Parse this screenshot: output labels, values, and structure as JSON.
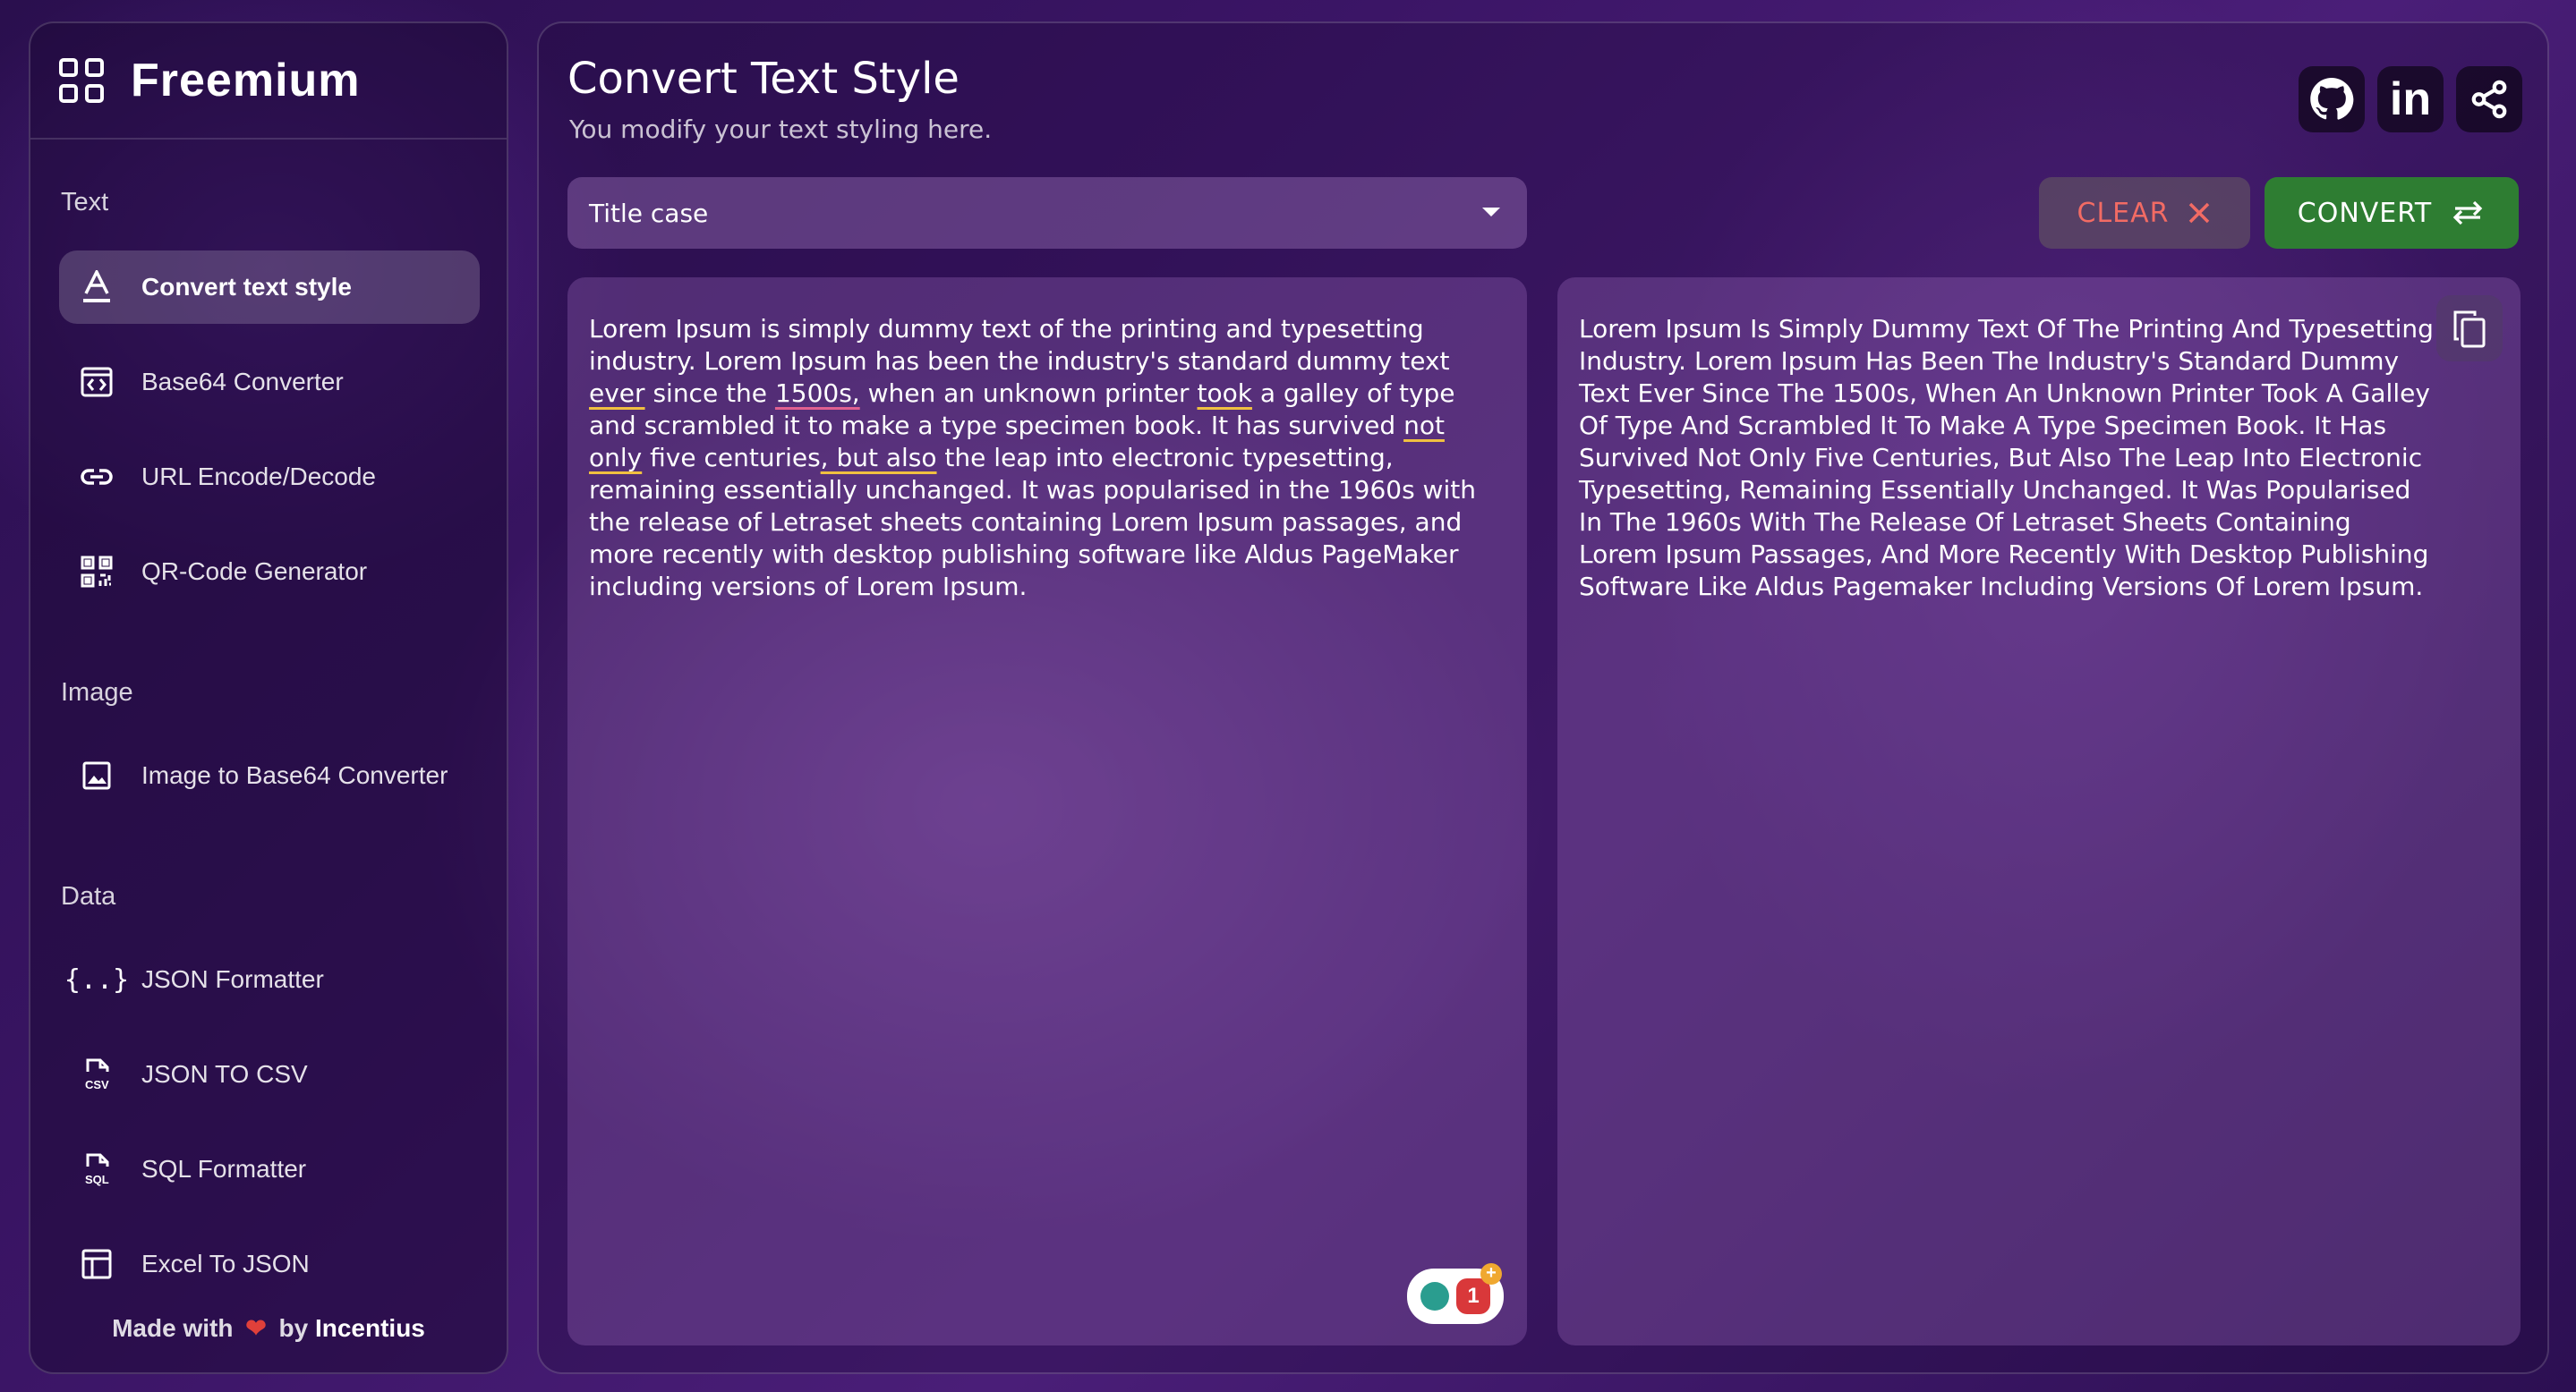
{
  "sidebar": {
    "brand": "Freemium",
    "sections": {
      "text": "Text",
      "image": "Image",
      "data": "Data"
    },
    "items": [
      {
        "label": "Convert text style",
        "icon": "text-format-icon"
      },
      {
        "label": "Base64 Converter",
        "icon": "code-box-icon"
      },
      {
        "label": "URL Encode/Decode",
        "icon": "link-icon"
      },
      {
        "label": "QR-Code Generator",
        "icon": "qr-code-icon"
      },
      {
        "label": "Image to Base64 Converter",
        "icon": "image-icon"
      },
      {
        "label": "JSON Formatter",
        "icon": "braces-icon"
      },
      {
        "label": "JSON TO CSV",
        "icon": "csv-file-icon"
      },
      {
        "label": "SQL Formatter",
        "icon": "sql-file-icon"
      },
      {
        "label": "Excel To JSON",
        "icon": "table-icon"
      }
    ],
    "footer": {
      "made_with": "Made with",
      "heart": "❤",
      "by": "by",
      "author": "Incentius"
    }
  },
  "header": {
    "title": "Convert Text Style",
    "subtitle": "You modify your text styling here."
  },
  "toolbar": {
    "selected_style": "Title case",
    "clear_label": "CLEAR",
    "convert_label": "CONVERT"
  },
  "input": {
    "parts": [
      "Lorem Ipsum is simply dummy text of the printing and typesetting industry. Lorem Ipsum has been the industry's standard dummy text ",
      "ever",
      " since the ",
      "1500s,",
      " when an unknown printer ",
      "took",
      " a galley of type and scrambled it to make a type specimen book. It has survived ",
      "not only",
      " five centuries",
      ", but also",
      " the leap into electronic typesetting, remaining essentially unchanged. It was popularised in the 1960s with the release of Letraset sheets containing Lorem Ipsum passages, and more recently with desktop publishing software like Aldus PageMaker including versions of Lorem Ipsum."
    ]
  },
  "output": {
    "text": "Lorem Ipsum Is Simply Dummy Text Of The Printing And Typesetting Industry. Lorem Ipsum Has Been The Industry's Standard Dummy Text Ever Since The 1500s, When An Unknown Printer Took A Galley Of Type And Scrambled It To Make A Type Specimen Book. It Has Survived Not Only Five Centuries, But Also The Leap Into Electronic Typesetting, Remaining Essentially Unchanged. It Was Popularised In The 1960s With The Release Of Letraset Sheets Containing Lorem Ipsum Passages, And More Recently With Desktop Publishing Software Like Aldus Pagemaker Including Versions Of Lorem Ipsum."
  },
  "grammar_badge": {
    "count": "1",
    "plus": "+"
  },
  "colors": {
    "convert": "#2e7d32",
    "clear_text": "#f26b64",
    "heart": "#e0403a"
  }
}
